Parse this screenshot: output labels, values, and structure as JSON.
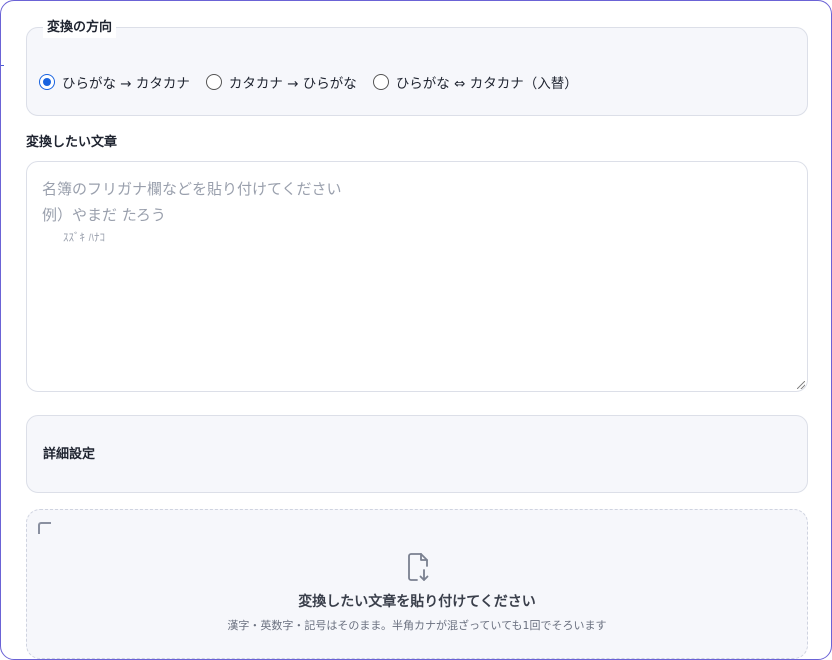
{
  "direction": {
    "legend": "変換の方向",
    "options": [
      {
        "label": "ひらがな → カタカナ",
        "checked": true
      },
      {
        "label": "カタカナ → ひらがな",
        "checked": false
      },
      {
        "label": "ひらがな ⇔ カタカナ（入替）",
        "checked": false
      }
    ]
  },
  "input": {
    "label": "変換したい文章",
    "placeholder_line1": "名簿のフリガナ欄などを貼り付けてください",
    "placeholder_line2": "例）やまだ たろう",
    "placeholder_line3": "      ｽｽﾞｷ ﾊﾅｺ"
  },
  "details": {
    "label": "詳細設定"
  },
  "dropzone": {
    "icon": "document-download-icon",
    "title": "変換したい文章を貼り付けてください",
    "subtitle": "漢字・英数字・記号はそのまま。半角カナが混ざっていても1回でそろいます"
  },
  "colors": {
    "accent": "#1a64e0",
    "frame": "#6b63d6",
    "panel": "#f6f7fb"
  }
}
